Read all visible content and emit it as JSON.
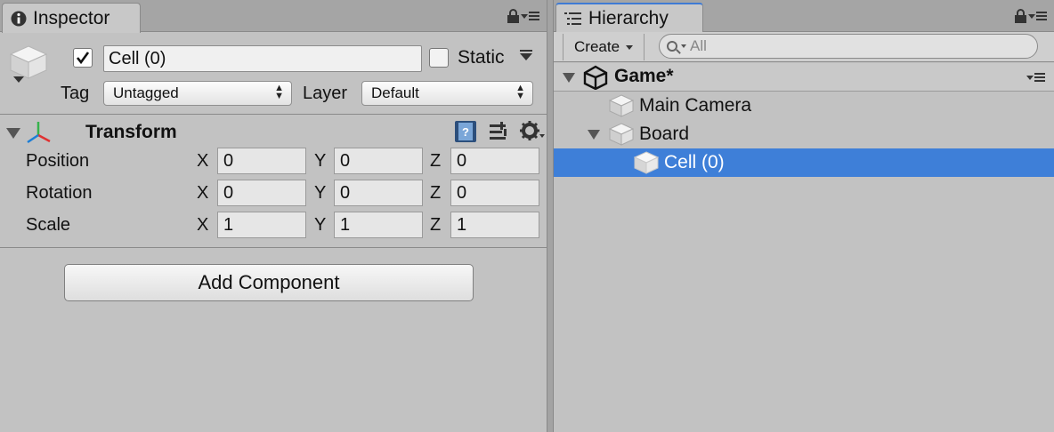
{
  "inspector": {
    "tab_label": "Inspector",
    "object": {
      "active": true,
      "name": "Cell (0)",
      "static_label": "Static",
      "static": false,
      "tag_label": "Tag",
      "tag_value": "Untagged",
      "layer_label": "Layer",
      "layer_value": "Default"
    },
    "transform": {
      "title": "Transform",
      "rows": [
        {
          "label": "Position",
          "x": "0",
          "y": "0",
          "z": "0"
        },
        {
          "label": "Rotation",
          "x": "0",
          "y": "0",
          "z": "0"
        },
        {
          "label": "Scale",
          "x": "1",
          "y": "1",
          "z": "1"
        }
      ],
      "axes": {
        "x": "X",
        "y": "Y",
        "z": "Z"
      }
    },
    "add_component_label": "Add Component"
  },
  "hierarchy": {
    "tab_label": "Hierarchy",
    "create_label": "Create",
    "search_placeholder": "All",
    "scene_name": "Game*",
    "items": [
      {
        "label": "Main Camera",
        "depth": 1,
        "expanded": null,
        "selected": false
      },
      {
        "label": "Board",
        "depth": 1,
        "expanded": true,
        "selected": false
      },
      {
        "label": "Cell (0)",
        "depth": 2,
        "expanded": null,
        "selected": true
      }
    ]
  },
  "colors": {
    "panel_bg": "#c2c2c2",
    "selection": "#3e7fd8",
    "active_tab_accent": "#3f7bd4"
  },
  "icons": [
    "info-icon",
    "lock-icon",
    "menu-icon",
    "cube-icon",
    "transform-icon",
    "help-icon",
    "preset-icon",
    "gear-icon",
    "list-icon",
    "search-icon",
    "unity-logo-icon",
    "foldout-arrow-icon"
  ]
}
